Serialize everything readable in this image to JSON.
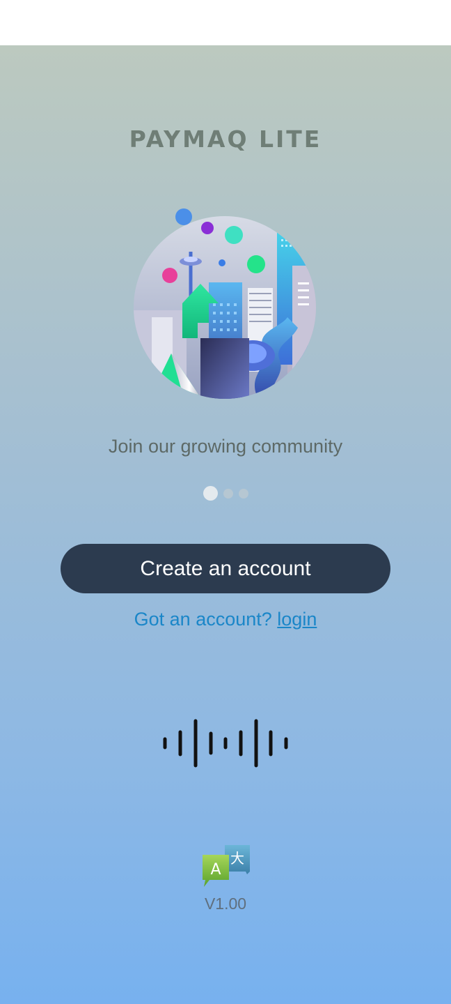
{
  "app": {
    "title": "PAYMAQ LITE"
  },
  "onboarding": {
    "tagline": "Join our growing community",
    "page_count": 3,
    "active_page": 1
  },
  "actions": {
    "create_account_label": "Create an account",
    "login_prompt": "Got an account?",
    "login_link": "login"
  },
  "footer": {
    "voice_icon": "sound-wave-icon",
    "language_icon": "translate-icon",
    "version": "V1.00"
  },
  "colors": {
    "title": "#6f7e76",
    "button_bg": "#2c3b4f",
    "link": "#1a86c8",
    "gradient_top": "#bcc9bf",
    "gradient_bottom": "#77b1ef"
  }
}
